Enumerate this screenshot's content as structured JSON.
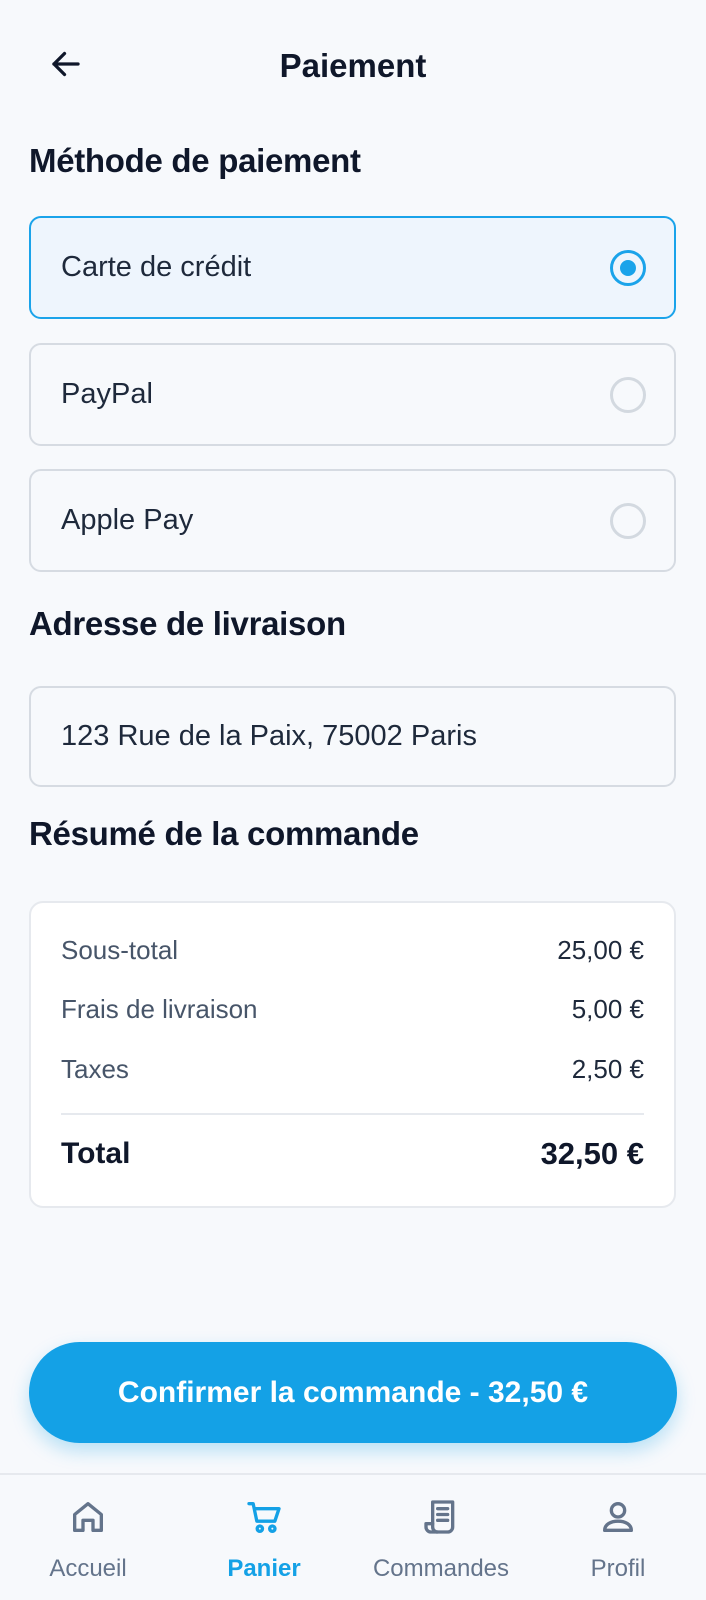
{
  "header": {
    "title": "Paiement",
    "back_icon": "arrow-left-icon"
  },
  "payment": {
    "section_title": "Méthode de paiement",
    "options": [
      {
        "label": "Carte de crédit",
        "selected": true
      },
      {
        "label": "PayPal",
        "selected": false
      },
      {
        "label": "Apple Pay",
        "selected": false
      }
    ]
  },
  "shipping": {
    "section_title": "Adresse de livraison",
    "address": "123 Rue de la Paix, 75002 Paris"
  },
  "summary": {
    "section_title": "Résumé de la commande",
    "rows": [
      {
        "label": "Sous-total",
        "value": "25,00 €"
      },
      {
        "label": "Frais de livraison",
        "value": "5,00 €"
      },
      {
        "label": "Taxes",
        "value": "2,50 €"
      }
    ],
    "total_label": "Total",
    "total_value": "32,50 €"
  },
  "confirm_button": {
    "label": "Confirmer la commande - 32,50 €"
  },
  "bottom_nav": {
    "items": [
      {
        "label": "Accueil",
        "icon": "home-icon",
        "active": false
      },
      {
        "label": "Panier",
        "icon": "cart-icon",
        "active": true
      },
      {
        "label": "Commandes",
        "icon": "receipt-icon",
        "active": false
      },
      {
        "label": "Profil",
        "icon": "user-icon",
        "active": false
      }
    ]
  },
  "colors": {
    "accent": "#14a1e6",
    "background": "#f7f9fc",
    "text": "#0f172a",
    "muted": "#64748b",
    "border": "#d6dbe2"
  }
}
